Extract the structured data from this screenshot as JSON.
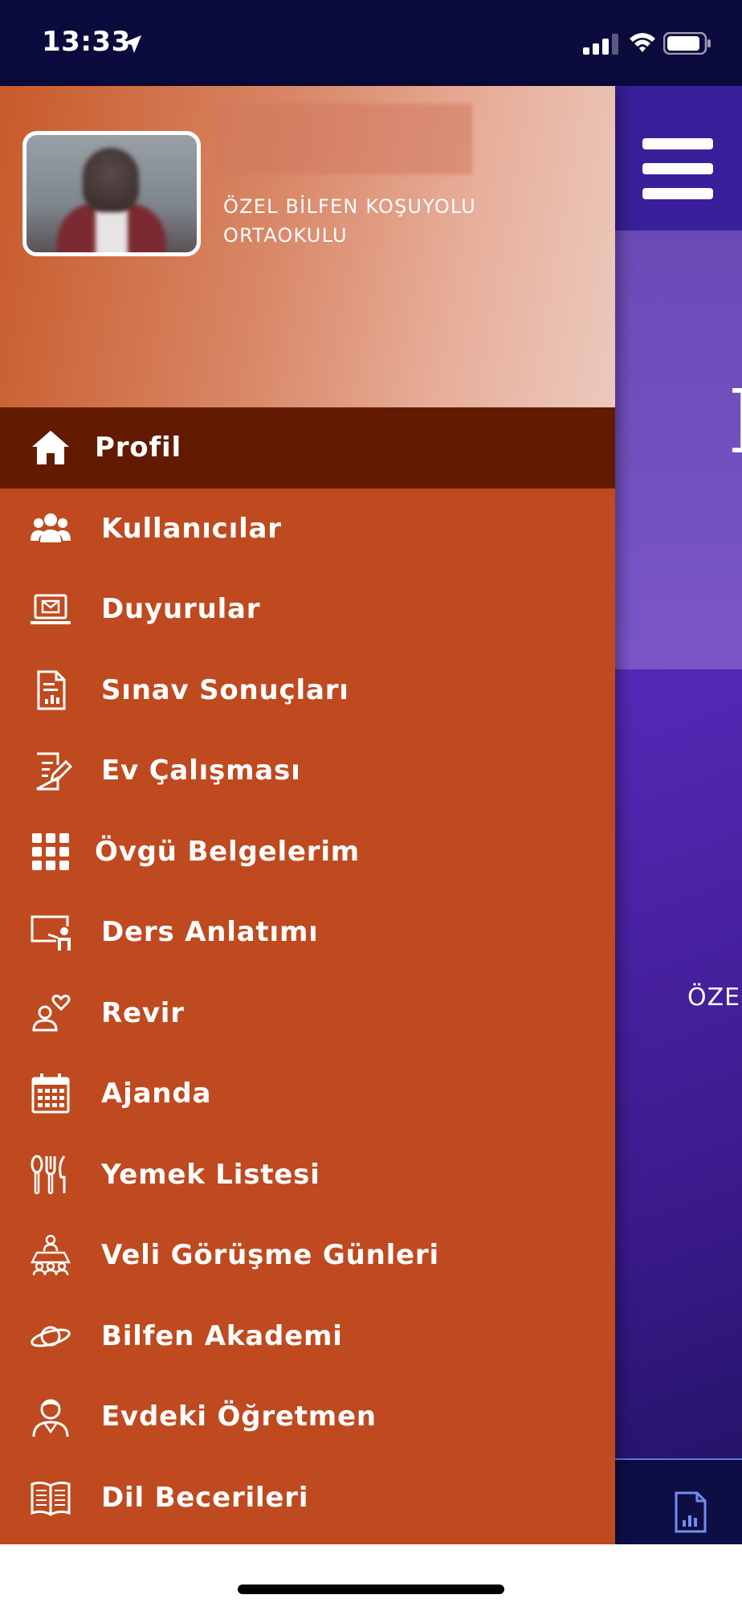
{
  "status_bar": {
    "time": "13:33",
    "location_icon": "location-arrow-icon",
    "signal_icon": "cellular-signal-icon",
    "wifi_icon": "wifi-icon",
    "battery_icon": "battery-icon"
  },
  "drawer": {
    "school_line1": "ÖZEL BİLFEN KOŞUYOLU",
    "school_line2": "ORTAOKULU",
    "accent_color": "#bf4a1f",
    "active_color": "#621b00",
    "menu": [
      {
        "label": "Profil",
        "icon": "home-icon"
      },
      {
        "label": "Kullanıcılar",
        "icon": "users-icon"
      },
      {
        "label": "Duyurular",
        "icon": "laptop-mail-icon"
      },
      {
        "label": "Sınav Sonuçları",
        "icon": "report-document-icon"
      },
      {
        "label": "Ev Çalışması",
        "icon": "homework-edit-icon"
      },
      {
        "label": "Övgü Belgelerim",
        "icon": "grid-icon"
      },
      {
        "label": "Ders Anlatımı",
        "icon": "teacher-board-icon"
      },
      {
        "label": "Revir",
        "icon": "health-person-icon"
      },
      {
        "label": "Ajanda",
        "icon": "calendar-icon"
      },
      {
        "label": "Yemek Listesi",
        "icon": "cutlery-icon"
      },
      {
        "label": "Veli Görüşme Günleri",
        "icon": "meeting-table-icon"
      },
      {
        "label": "Bilfen Akademi",
        "icon": "planet-icon"
      },
      {
        "label": "Evdeki Öğretmen",
        "icon": "teacher-person-icon"
      },
      {
        "label": "Dil Becerileri",
        "icon": "open-book-icon"
      }
    ]
  },
  "background_app": {
    "hero_letter": "E",
    "school_snippet": "ÖZE",
    "menu_icon": "hamburger-menu-icon",
    "bottom_icon": "report-document-icon"
  }
}
